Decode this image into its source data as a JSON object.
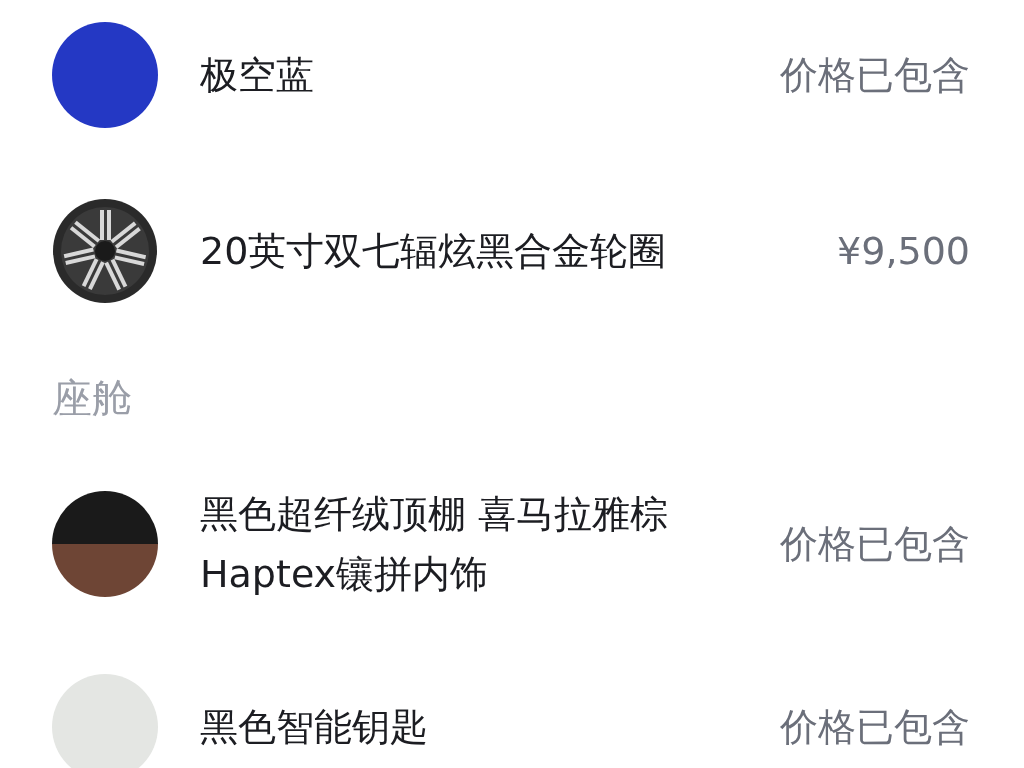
{
  "sections": [
    {
      "items": [
        {
          "name": "极空蓝",
          "price": "价格已包含",
          "kind": "swatch",
          "color": "#2438c4"
        },
        {
          "name": "20英寸双七辐炫黑合金轮圈",
          "price": "¥9,500",
          "kind": "wheel"
        }
      ]
    },
    {
      "title": "座舱",
      "items": [
        {
          "name": "黑色超纤绒顶棚 喜马拉雅棕Haptex镶拼内饰",
          "price": "价格已包含",
          "kind": "two-tone"
        },
        {
          "name": "黑色智能钥匙",
          "price": "价格已包含",
          "kind": "key"
        }
      ]
    }
  ]
}
